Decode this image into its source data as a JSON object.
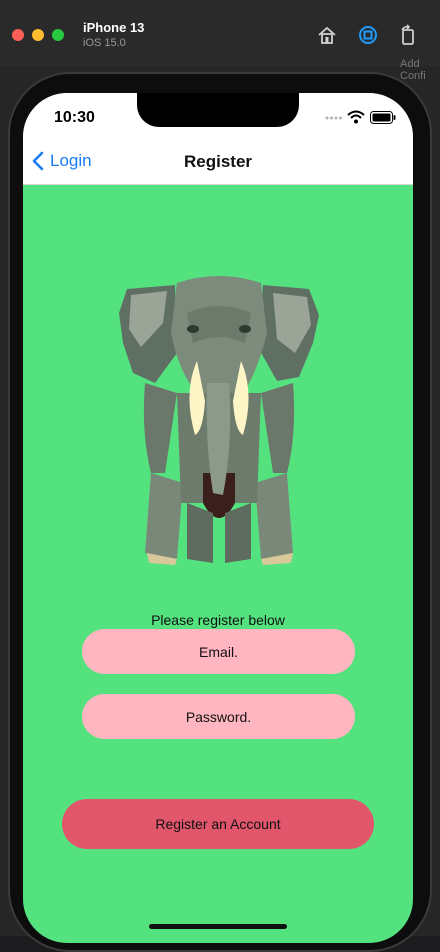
{
  "simulator": {
    "device": "iPhone 13",
    "os": "iOS 15.0"
  },
  "background_hint": "Add Confi",
  "status_bar": {
    "time": "10:30"
  },
  "nav": {
    "back_label": "Login",
    "title": "Register"
  },
  "form": {
    "prompt": "Please register below",
    "email_placeholder": "Email.",
    "password_placeholder": "Password.",
    "register_label": "Register an Account"
  },
  "colors": {
    "screen_bg": "#54e27f",
    "field_bg": "#ffb6c1",
    "button_bg": "#e2566c",
    "link": "#1a7cf5"
  },
  "icons": [
    "home-icon",
    "screenshot-icon",
    "rotate-icon",
    "back-chevron-icon",
    "signal-dots-icon",
    "wifi-icon",
    "battery-icon",
    "elephant-illustration"
  ]
}
